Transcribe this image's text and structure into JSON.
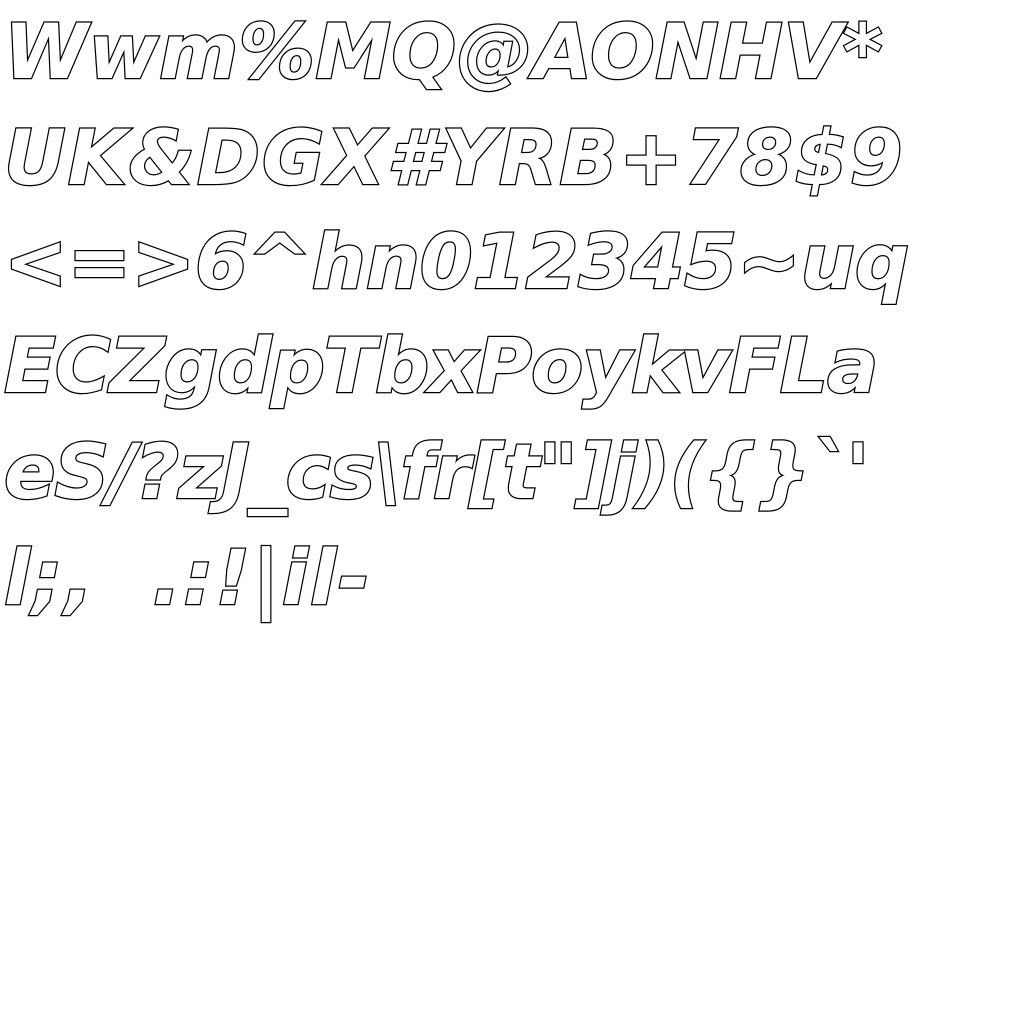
{
  "glyph_rows": [
    "Wwm%MQ@AONHV*",
    "UK&DGX#YRB+78$9",
    "<=>6^hn012345~uq",
    "ECZgdpTbxPoykvFLa",
    "eS/?zJ_cs\\fr[t\"]j)({}`'",
    "l;,  .:!|il-"
  ],
  "colors": {
    "background": "#ffffff",
    "glyph_outline": "#000000",
    "glyph_fill": "#ffffff"
  }
}
